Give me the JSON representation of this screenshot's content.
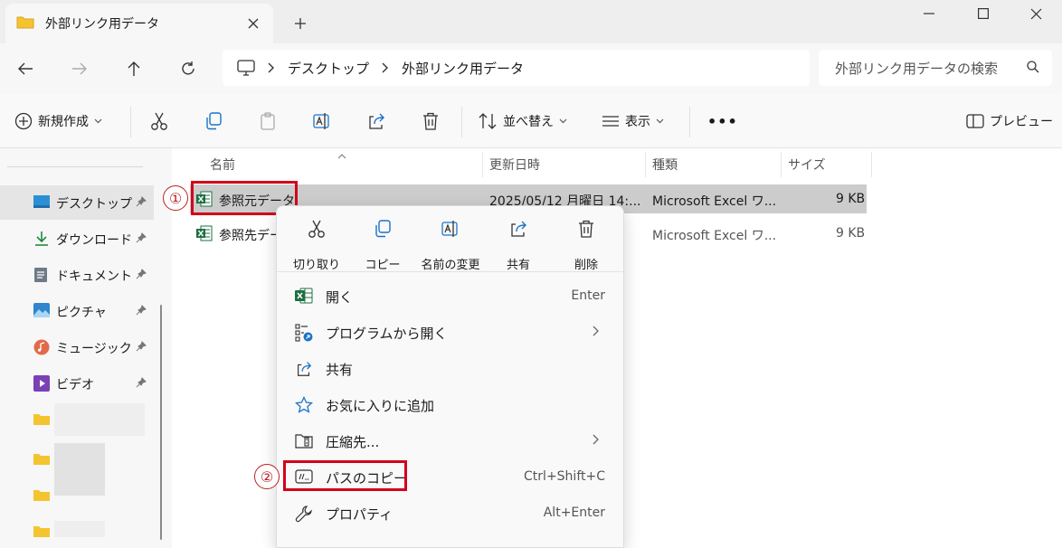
{
  "window": {
    "tab_title": "外部リンク用データ",
    "new_tab": "+"
  },
  "address": {
    "crumbs": [
      "デスクトップ",
      "外部リンク用データ"
    ],
    "search_placeholder": "外部リンク用データの検索"
  },
  "toolbar": {
    "new_label": "新規作成",
    "sort_label": "並べ替え",
    "view_label": "表示",
    "more_label": "•••",
    "preview_label": "プレビュー"
  },
  "sidebar": {
    "items": [
      {
        "label": "デスクトップ",
        "icon": "desktop-icon"
      },
      {
        "label": "ダウンロード",
        "icon": "download-icon"
      },
      {
        "label": "ドキュメント",
        "icon": "document-icon"
      },
      {
        "label": "ピクチャ",
        "icon": "picture-icon"
      },
      {
        "label": "ミュージック",
        "icon": "music-icon"
      },
      {
        "label": "ビデオ",
        "icon": "video-icon"
      }
    ]
  },
  "columns": {
    "name": "名前",
    "modified": "更新日時",
    "type": "種類",
    "size": "サイズ"
  },
  "files": [
    {
      "name": "参照元データ",
      "modified": "2025/05/12 月曜日 14:...",
      "type": "Microsoft Excel ワ...",
      "size": "9 KB"
    },
    {
      "name": "参照先デー",
      "modified": "",
      "type": "Microsoft Excel ワ...",
      "size": "9 KB"
    }
  ],
  "context_menu": {
    "actions": [
      {
        "label": "切り取り",
        "icon": "scissors-icon"
      },
      {
        "label": "コピー",
        "icon": "copy-icon"
      },
      {
        "label": "名前の変更",
        "icon": "rename-icon"
      },
      {
        "label": "共有",
        "icon": "share-icon"
      },
      {
        "label": "削除",
        "icon": "trash-icon"
      }
    ],
    "items": [
      {
        "label": "開く",
        "shortcut": "Enter"
      },
      {
        "label": "プログラムから開く",
        "shortcut": ""
      },
      {
        "label": "共有",
        "shortcut": ""
      },
      {
        "label": "お気に入りに追加",
        "shortcut": ""
      },
      {
        "label": "圧縮先...",
        "shortcut": ""
      },
      {
        "label": "パスのコピー",
        "shortcut": "Ctrl+Shift+C"
      },
      {
        "label": "プロパティ",
        "shortcut": "Alt+Enter"
      }
    ]
  },
  "callouts": [
    "①",
    "②"
  ],
  "colors": {
    "highlight": "#d3001b",
    "excel_green": "#1d6f42",
    "accent_blue": "#1a73c9",
    "folder_yellow": "#f4c430"
  }
}
